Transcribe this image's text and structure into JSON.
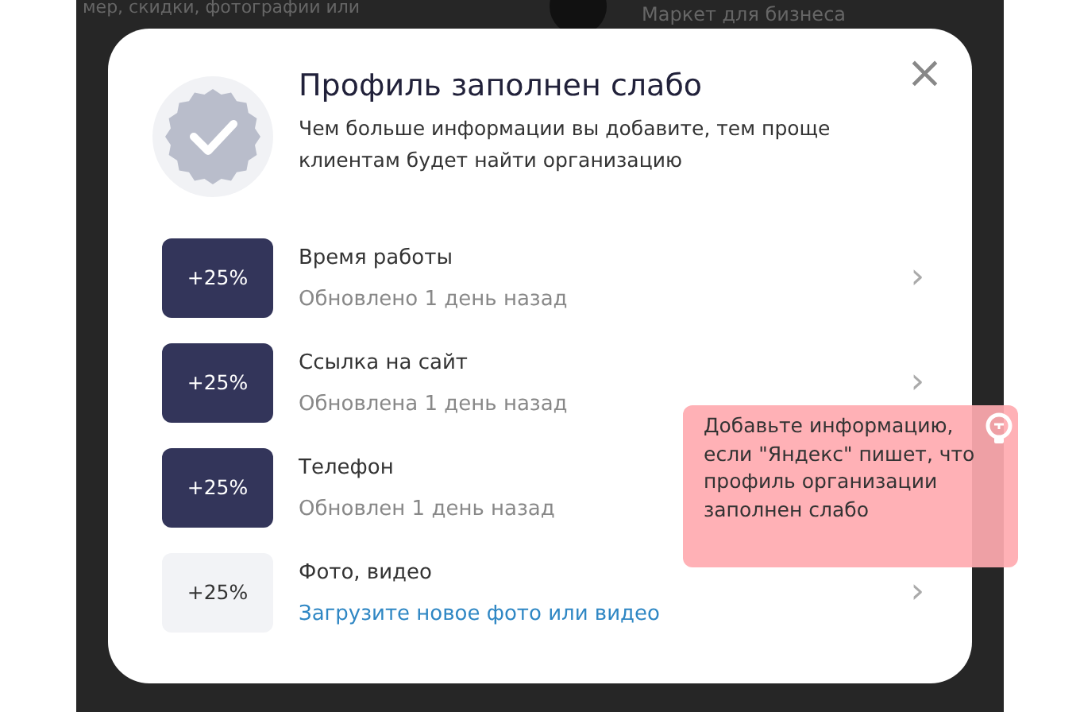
{
  "background": {
    "left_text": "мер, скидки, фотографии или",
    "right_text": "Маркет для бизнеса"
  },
  "dialog": {
    "title": "Профиль заполнен слабо",
    "subtitle": "Чем больше информации вы добавите, тем проще клиентам будет найти организацию",
    "close": "×",
    "items": [
      {
        "badge": "+25%",
        "title": "Время работы",
        "subtitle": "Обновлено 1 день назад",
        "done": true,
        "chevron": "›"
      },
      {
        "badge": "+25%",
        "title": "Ссылка на сайт",
        "subtitle": "Обновлена 1 день назад",
        "done": true,
        "chevron": "›"
      },
      {
        "badge": "+25%",
        "title": "Телефон",
        "subtitle": "Обновлен 1 день назад",
        "done": true
      },
      {
        "badge": "+25%",
        "title": "Фото, видео",
        "subtitle": "Загрузите новое фото или видео",
        "done": false,
        "chevron": "›"
      }
    ]
  },
  "tip": {
    "text": "Добавьте информацию, если \"Яндекс\" пишет, что профиль организации заполнен слабо"
  }
}
